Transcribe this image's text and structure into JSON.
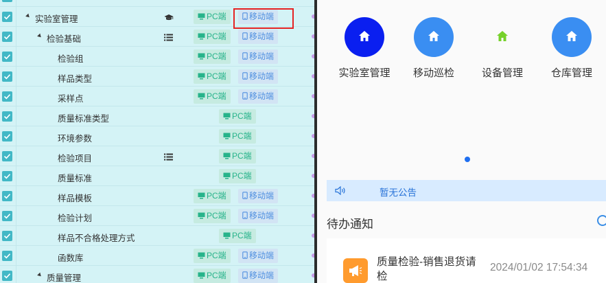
{
  "tree": {
    "rows": [
      {
        "label": "实验室管理",
        "level": 1,
        "expanded": true,
        "row_icon": "graduation-cap-icon",
        "tags": [
          "pc",
          "mobile"
        ],
        "checked": true
      },
      {
        "label": "检验基础",
        "level": 2,
        "expanded": true,
        "row_icon": "list-icon",
        "tags": [
          "pc",
          "mobile"
        ],
        "checked": true
      },
      {
        "label": "检验组",
        "level": 3,
        "tags": [
          "pc",
          "mobile"
        ],
        "checked": true
      },
      {
        "label": "样品类型",
        "level": 3,
        "tags": [
          "pc",
          "mobile"
        ],
        "checked": true
      },
      {
        "label": "采样点",
        "level": 3,
        "tags": [
          "pc",
          "mobile"
        ],
        "checked": true
      },
      {
        "label": "质量标准类型",
        "level": 3,
        "tags": [
          "pc"
        ],
        "checked": true
      },
      {
        "label": "环境参数",
        "level": 3,
        "tags": [
          "pc"
        ],
        "checked": true
      },
      {
        "label": "检验项目",
        "level": 3,
        "row_icon": "list-icon",
        "tags": [
          "pc"
        ],
        "checked": true
      },
      {
        "label": "质量标准",
        "level": 3,
        "tags": [
          "pc"
        ],
        "checked": true
      },
      {
        "label": "样品模板",
        "level": 3,
        "tags": [
          "pc",
          "mobile"
        ],
        "checked": true
      },
      {
        "label": "检验计划",
        "level": 3,
        "tags": [
          "pc",
          "mobile"
        ],
        "checked": true
      },
      {
        "label": "样品不合格处理方式",
        "level": 3,
        "tags": [
          "pc"
        ],
        "checked": true
      },
      {
        "label": "函数库",
        "level": 3,
        "tags": [
          "pc",
          "mobile"
        ],
        "checked": true
      },
      {
        "label": "质量管理",
        "level": 2,
        "expanded": true,
        "tags": [
          "pc",
          "mobile"
        ],
        "checked": true
      }
    ],
    "pc_label": "PC端",
    "mobile_label": "移动端",
    "colors": {
      "bg": "#d4f3f6",
      "checkbox": "#42b8c6",
      "pc_tag": "#27b38a",
      "mobile_tag": "#4f8fe0",
      "highlight": "#e52323"
    }
  },
  "phone": {
    "apps": [
      {
        "label": "实验室管理",
        "icon": "home-icon",
        "color": "#0a1ff0"
      },
      {
        "label": "移动巡检",
        "icon": "home-icon",
        "color": "#3a8ef2"
      },
      {
        "label": "设备管理",
        "icon": "home-icon",
        "color": "#76d12a"
      },
      {
        "label": "仓库管理",
        "icon": "home-icon",
        "color": "#3a8ef2"
      }
    ],
    "notice": {
      "icon": "speaker-icon",
      "text": "暂无公告"
    },
    "todo": {
      "title": "待办通知",
      "items": [
        {
          "icon": "megaphone-icon",
          "text": "质量检验-销售退货请检",
          "time": "2024/01/02 17:54:34"
        }
      ]
    }
  }
}
